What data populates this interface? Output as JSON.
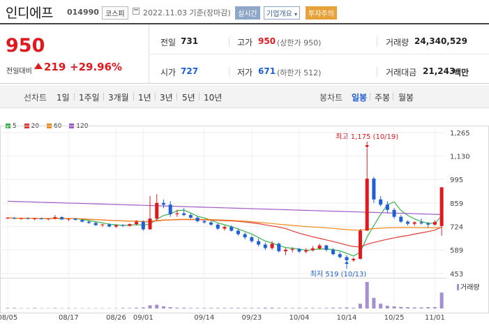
{
  "header": {
    "name": "인디에프",
    "code": "014990",
    "market": "코스피",
    "date": "2022.11.03 기준(장마감)",
    "btn_realtime": "실시간",
    "btn_company": "기업개요",
    "btn_caution": "투자주의"
  },
  "quote": {
    "price": "950",
    "vs_label": "전일대비",
    "change": "219",
    "rate": "+29.96%",
    "prev_close_label": "전일",
    "prev_close": "731",
    "high_label": "고가",
    "high": "950",
    "upper_limit": "(상한가 950)",
    "volume_label": "거래량",
    "volume": "24,340,529",
    "open_label": "시가",
    "open": "727",
    "low_label": "저가",
    "low": "671",
    "lower_limit": "(하한가 512)",
    "amount_label": "거래대금",
    "amount": "21,243",
    "amount_unit": "백만"
  },
  "colors": {
    "up": "#e0191f",
    "down": "#1f5fd6",
    "ma5": "#36b34a",
    "ma20": "#e53935",
    "ma60": "#f08a1c",
    "ma120": "#a05bc6",
    "volume": "#a48fd0"
  },
  "periods": {
    "line_label": "선차트",
    "line_tabs": [
      "1일",
      "1주일",
      "3개월",
      "1년",
      "3년",
      "5년",
      "10년"
    ],
    "candle_label": "봉차트",
    "candle_tabs": [
      "일봉",
      "주봉",
      "월봉"
    ],
    "active_candle": "일봉"
  },
  "chart_data": {
    "type": "candlestick",
    "ma_legend": [
      "5",
      "20",
      "60",
      "120"
    ],
    "y_ticks": [
      1265,
      1130,
      995,
      859,
      724,
      589,
      453
    ],
    "x_labels": [
      "08/05",
      "08/17",
      "08/26",
      "09/01",
      "09/14",
      "09/23",
      "10/04",
      "10/14",
      "10/25",
      "11/01"
    ],
    "max_label": "최고 1,175 (10/19)",
    "min_label": "최저 519 (10/13)",
    "volume_label": "거래량",
    "candles": [
      [
        772,
        778,
        768,
        774
      ],
      [
        774,
        779,
        766,
        770
      ],
      [
        770,
        775,
        764,
        772
      ],
      [
        772,
        777,
        765,
        768
      ],
      [
        768,
        774,
        760,
        771
      ],
      [
        771,
        776,
        765,
        766
      ],
      [
        766,
        772,
        760,
        770
      ],
      [
        770,
        790,
        765,
        778
      ],
      [
        778,
        783,
        762,
        765
      ],
      [
        765,
        772,
        755,
        769
      ],
      [
        769,
        774,
        760,
        762
      ],
      [
        762,
        768,
        748,
        752
      ],
      [
        752,
        758,
        740,
        745
      ],
      [
        745,
        750,
        728,
        732
      ],
      [
        732,
        740,
        722,
        736
      ],
      [
        736,
        742,
        720,
        724
      ],
      [
        724,
        736,
        716,
        732
      ],
      [
        732,
        738,
        722,
        728
      ],
      [
        728,
        742,
        724,
        738
      ],
      [
        738,
        760,
        730,
        752
      ],
      [
        752,
        760,
        700,
        708
      ],
      [
        708,
        900,
        705,
        770
      ],
      [
        770,
        910,
        760,
        860
      ],
      [
        860,
        880,
        830,
        850
      ],
      [
        850,
        870,
        780,
        795
      ],
      [
        795,
        820,
        780,
        800
      ],
      [
        800,
        830,
        785,
        790
      ],
      [
        790,
        800,
        770,
        775
      ],
      [
        775,
        782,
        748,
        755
      ],
      [
        755,
        762,
        740,
        748
      ],
      [
        748,
        756,
        728,
        735
      ],
      [
        735,
        742,
        705,
        712
      ],
      [
        712,
        730,
        700,
        722
      ],
      [
        722,
        730,
        695,
        700
      ],
      [
        700,
        712,
        672,
        680
      ],
      [
        680,
        690,
        650,
        662
      ],
      [
        662,
        672,
        630,
        640
      ],
      [
        640,
        655,
        610,
        620
      ],
      [
        620,
        632,
        590,
        600
      ],
      [
        600,
        640,
        590,
        625
      ],
      [
        625,
        632,
        575,
        582
      ],
      [
        582,
        600,
        560,
        590
      ],
      [
        590,
        605,
        575,
        595
      ],
      [
        595,
        600,
        572,
        580
      ],
      [
        580,
        600,
        570,
        588
      ],
      [
        588,
        612,
        580,
        598
      ],
      [
        598,
        625,
        590,
        615
      ],
      [
        615,
        620,
        580,
        590
      ],
      [
        590,
        600,
        558,
        565
      ],
      [
        565,
        578,
        540,
        548
      ],
      [
        548,
        560,
        519,
        530
      ],
      [
        530,
        545,
        522,
        538
      ],
      [
        538,
        710,
        535,
        700
      ],
      [
        700,
        1175,
        720,
        1000
      ],
      [
        1000,
        1010,
        860,
        880
      ],
      [
        880,
        900,
        840,
        850
      ],
      [
        850,
        870,
        800,
        820
      ],
      [
        820,
        830,
        770,
        780
      ],
      [
        780,
        790,
        745,
        752
      ],
      [
        752,
        760,
        730,
        740
      ],
      [
        740,
        755,
        728,
        748
      ],
      [
        748,
        770,
        735,
        742
      ],
      [
        742,
        750,
        720,
        735
      ],
      [
        735,
        760,
        728,
        750
      ],
      [
        727,
        950,
        671,
        950
      ]
    ],
    "volumes": [
      2,
      2,
      1,
      1,
      2,
      1,
      1,
      2,
      1,
      1,
      1,
      1,
      1,
      1,
      1,
      1,
      1,
      2,
      2,
      3,
      4,
      12,
      14,
      8,
      5,
      3,
      3,
      2,
      2,
      2,
      2,
      2,
      2,
      2,
      2,
      2,
      2,
      2,
      3,
      3,
      2,
      2,
      2,
      2,
      2,
      2,
      2,
      2,
      3,
      3,
      4,
      3,
      18,
      100,
      40,
      18,
      10,
      8,
      6,
      5,
      4,
      4,
      5,
      5,
      60
    ]
  }
}
